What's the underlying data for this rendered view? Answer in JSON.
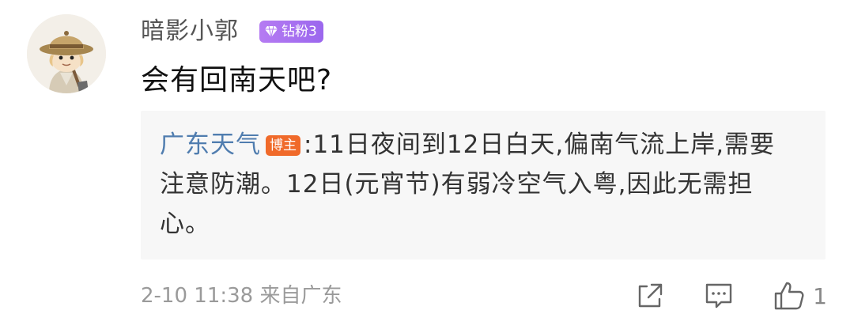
{
  "comment": {
    "username": "暗影小郭",
    "fan_badge": "钻粉3",
    "text": "会有回南天吧?",
    "reply": {
      "author": "广东天气",
      "author_badge": "博主",
      "text": ":11日夜间到12日白天,偏南气流上岸,需要注意防潮。12日(元宵节)有弱冷空气入粤,因此无需担心。"
    },
    "timestamp": "2-10 11:38 来自广东",
    "like_count": "1"
  },
  "colors": {
    "author_link": "#507daf",
    "blogger_badge": "#f06a2a",
    "fan_badge": "#a870f0",
    "muted": "#9a9a9a"
  },
  "icons": {
    "avatar": "cartoon-explorer-avatar",
    "fan_badge": "gem-icon",
    "share": "share-icon",
    "reply": "comment-icon",
    "like": "thumbs-up-icon"
  }
}
